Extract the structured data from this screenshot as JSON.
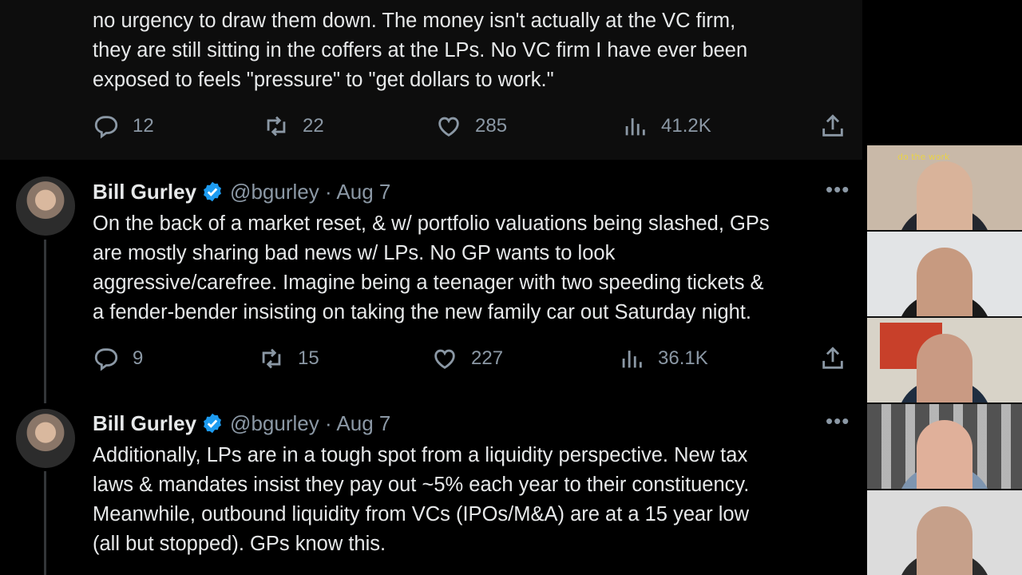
{
  "tweets": [
    {
      "body": "no urgency to draw them down. The money isn't actually at the VC firm,\nthey are still sitting in the coffers at the LPs. No VC firm I have ever been\nexposed to feels \"pressure\" to \"get dollars to work.\"",
      "replies": "12",
      "retweets": "22",
      "likes": "285",
      "views": "41.2K"
    },
    {
      "name": "Bill Gurley",
      "handle": "@bgurley · Aug 7",
      "body": "On the back of a market reset, & w/ portfolio valuations being slashed, GPs\nare mostly sharing bad news w/ LPs. No GP wants to look\naggressive/carefree. Imagine being a teenager with two speeding tickets &\na fender-bender insisting on taking the new family car out Saturday night.",
      "replies": "9",
      "retweets": "15",
      "likes": "227",
      "views": "36.1K"
    },
    {
      "name": "Bill Gurley",
      "handle": "@bgurley · Aug 7",
      "body": "Additionally, LPs are in a tough spot from a liquidity perspective. New tax\nlaws & mandates insist they pay out ~5% each year to their constituency.\nMeanwhile, outbound liquidity from VCs (IPOs/M&A) are at a 15 year low\n(all but stopped). GPs know this."
    }
  ],
  "video_call": {
    "neon_sign": "do the work"
  },
  "colors": {
    "verified": "#1d9bf0",
    "muted": "#8b98a5",
    "text": "#e7e9ea"
  },
  "icons": [
    "reply-icon",
    "retweet-icon",
    "like-icon",
    "views-icon",
    "share-icon",
    "verified-badge-icon",
    "more-icon"
  ]
}
